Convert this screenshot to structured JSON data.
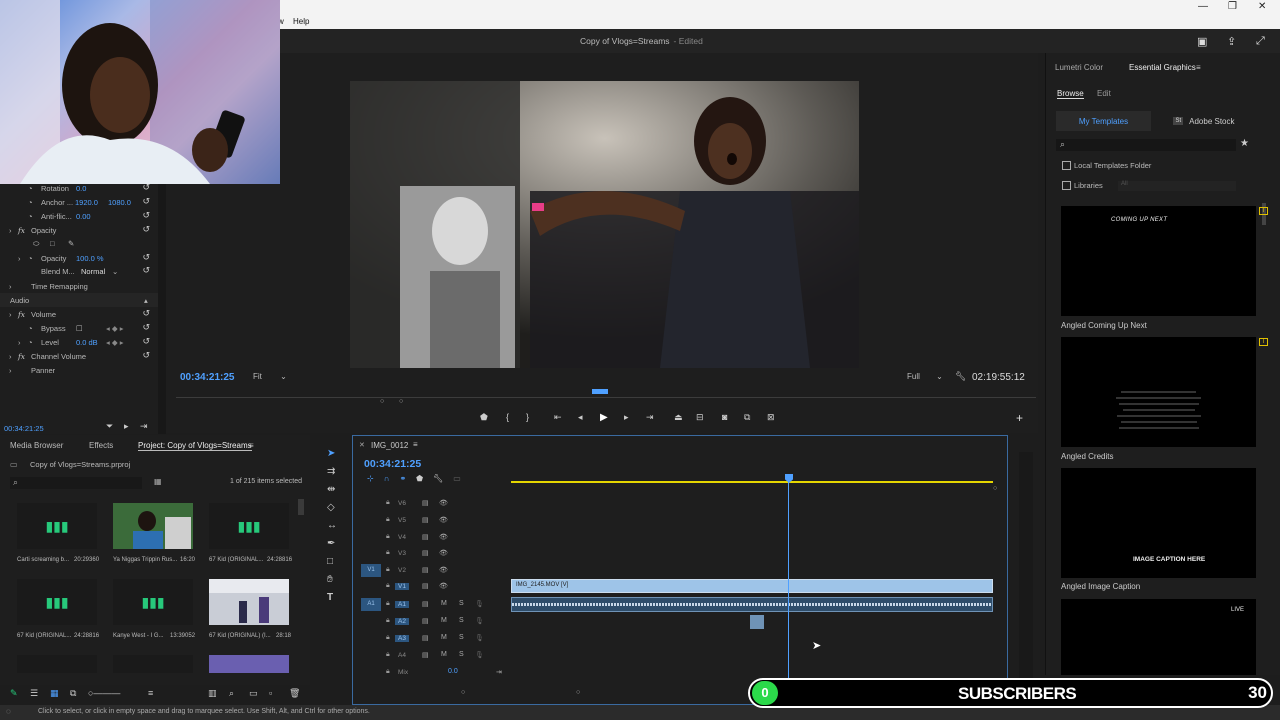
{
  "menubar": {
    "item_w": "w",
    "help": "Help"
  },
  "window": {
    "title": "Copy of Vlogs=Streams",
    "edited": "- Edited"
  },
  "effect_controls": {
    "rotation_label": "Rotation",
    "rotation_value": "0.0",
    "anchor_label": "Anchor ...",
    "anchor_x": "1920.0",
    "anchor_y": "1080.0",
    "antiflicker_label": "Anti-flic...",
    "antiflicker_value": "0.00",
    "opacity_section": "Opacity",
    "opacity_label": "Opacity",
    "opacity_value": "100.0 %",
    "blend_label": "Blend M...",
    "blend_value": "Normal",
    "time_remapping": "Time Remapping",
    "audio_header": "Audio",
    "volume": "Volume",
    "bypass_label": "Bypass",
    "level_label": "Level",
    "level_value": "0.0 dB",
    "channel_volume": "Channel Volume",
    "panner": "Panner",
    "timecode": "00:34:21:25"
  },
  "program": {
    "timecode": "00:34:21:25",
    "fit": "Fit",
    "quality": "Full",
    "duration": "02:19:55:12"
  },
  "essential_graphics": {
    "tab_lumetri": "Lumetri Color",
    "tab_eg": "Essential Graphics",
    "sub_browse": "Browse",
    "sub_edit": "Edit",
    "my_templates": "My Templates",
    "adobe_stock": "Adobe Stock",
    "local_templates": "Local Templates Folder",
    "libraries": "Libraries",
    "libraries_select": "All",
    "templates": [
      {
        "name": "Angled Coming Up Next",
        "preview_text": "COMING UP NEXT"
      },
      {
        "name": "Angled Credits",
        "preview_text": ""
      },
      {
        "name": "Angled Image Caption",
        "preview_text": "IMAGE CAPTION HERE"
      },
      {
        "name": "",
        "preview_text": "LIVE"
      }
    ]
  },
  "project": {
    "tab_media": "Media Browser",
    "tab_effects": "Effects",
    "tab_project": "Project: Copy of Vlogs=Streams",
    "file": "Copy of Vlogs=Streams.prproj",
    "count": "1 of 215 items selected",
    "items": [
      {
        "name": "Carti screaming b...",
        "dur": "20:29360"
      },
      {
        "name": "Ya Niggas Trippin Rus...",
        "dur": "16:20"
      },
      {
        "name": "67 Kid (ORIGINAL...",
        "dur": "24:28816"
      },
      {
        "name": "67 Kid (ORIGINAL...",
        "dur": "24:28816"
      },
      {
        "name": "Kanye West - I G...",
        "dur": "13:39052"
      },
      {
        "name": "67 Kid (ORIGINAL) (I...",
        "dur": "28:18"
      }
    ]
  },
  "timeline": {
    "sequence": "IMG_0012",
    "timecode": "00:34:21:25",
    "video_tracks": [
      "V6",
      "V5",
      "V4",
      "V3",
      "V2",
      "V1"
    ],
    "audio_tracks": [
      "A1",
      "A2",
      "A3",
      "A4"
    ],
    "target_v": "V1",
    "target_a": "A1",
    "mix": "Mix",
    "mix_value": "0.0",
    "clip_v1": "IMG_2145.MOV [V]",
    "m": "M",
    "s": "S"
  },
  "status": "Click to select, or click in empty space and drag to marquee select. Use Shift, Alt, and Ctrl for other options.",
  "overlay": {
    "subscriber_count": "0",
    "subscriber_label": "SUBSCRIBERS",
    "goal": "30"
  },
  "colors": {
    "accent": "#4fa0ff",
    "audio_green": "#27c97b",
    "sub_green": "#2bd94a"
  }
}
